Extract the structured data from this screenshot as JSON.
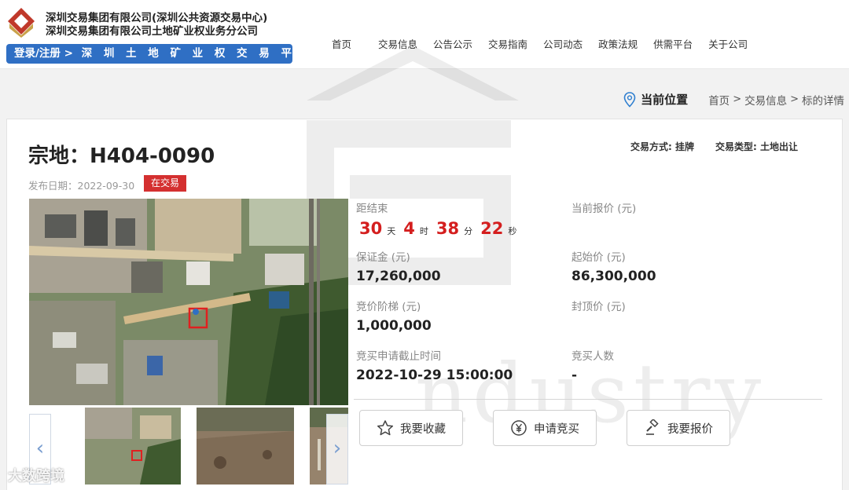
{
  "header": {
    "org_line1": "深圳交易集团有限公司(深圳公共资源交易中心)",
    "org_line2": "深圳交易集团有限公司土地矿业权业务分公司",
    "login_label": "登录/注册 >",
    "platform_label": "深 圳 土 地 矿 业 权 交 易 平 台",
    "nav": [
      "首页",
      "交易信息",
      "公告公示",
      "交易指南",
      "公司动态",
      "政策法规",
      "供需平台",
      "关于公司"
    ]
  },
  "background_word": "ndustry",
  "breadcrumb": {
    "label": "当前位置",
    "items": [
      "首页",
      "交易信息",
      "标的详情"
    ],
    "separator": ">"
  },
  "listing": {
    "title": "宗地：H404-0090",
    "publish_date": "发布日期：2022-09-30",
    "status": "在交易",
    "trade_method": "交易方式: 挂牌",
    "trade_type": "交易类型: 土地出让"
  },
  "countdown": {
    "label": "距结束",
    "days": "30",
    "days_unit": "天",
    "hours": "4",
    "hours_unit": "时",
    "minutes": "38",
    "minutes_unit": "分",
    "seconds": "22",
    "seconds_unit": "秒"
  },
  "fields": {
    "current_bid_label": "当前报价 (元)",
    "current_bid_value": "",
    "deposit_label": "保证金 (元)",
    "deposit_value": "17,260,000",
    "start_price_label": "起始价 (元)",
    "start_price_value": "86,300,000",
    "increment_label": "竞价阶梯 (元)",
    "increment_value": "1,000,000",
    "cap_price_label": "封顶价 (元)",
    "cap_price_value": "",
    "deadline_label": "竞买申请截止时间",
    "deadline_value": "2022-10-29 15:00:00",
    "bidders_label": "竞买人数",
    "bidders_value": "-"
  },
  "actions": {
    "favorite": "我要收藏",
    "apply": "申请竞买",
    "bid": "我要报价"
  },
  "gallery": {
    "prev_icon": "chevron-left-icon",
    "next_icon": "chevron-right-icon",
    "prev_glyph": "‹",
    "next_glyph": "›"
  },
  "corner_watermark": "大数跨境",
  "colors": {
    "accent_blue": "#2f6fc4",
    "status_red": "#d43030",
    "countdown_red": "#d41e1e"
  }
}
